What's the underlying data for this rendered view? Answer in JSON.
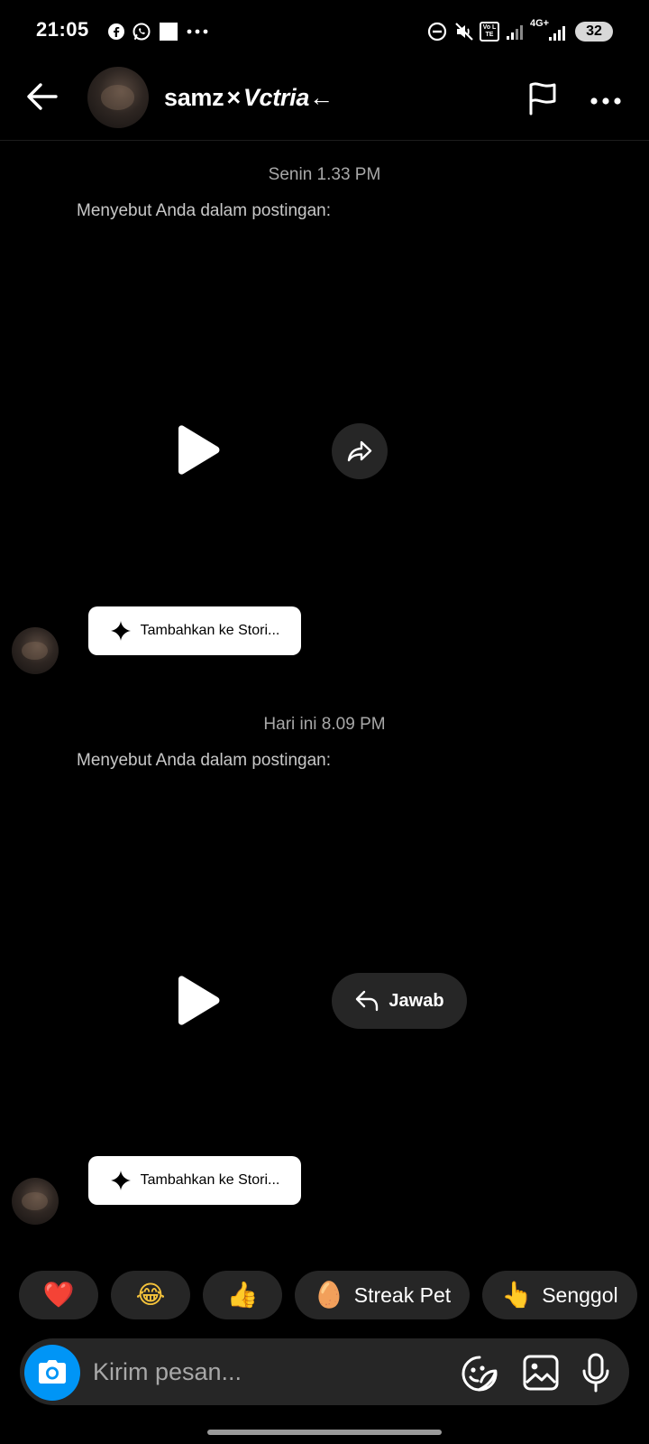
{
  "status_bar": {
    "time": "21:05",
    "left_icons": [
      "facebook-icon",
      "whatsapp-icon",
      "square-icon",
      "more-dots-icon"
    ],
    "right_icons": [
      "dnd-icon",
      "mute-icon",
      "volte-icon",
      "signal-icon",
      "4g-signal-icon"
    ],
    "network": "4G+",
    "volte": "Vo LTE",
    "battery": "32"
  },
  "header": {
    "name_part1": "samz",
    "name_cross": "×",
    "name_part2": "Vctria",
    "name_arrow": "←"
  },
  "messages": [
    {
      "timestamp": "Senin 1.33 PM",
      "mention_text": "Menyebut Anda dalam postingan:",
      "action_label": "",
      "story_button": "Tambahkan ke Stori..."
    },
    {
      "timestamp": "Hari ini 8.09 PM",
      "mention_text": "Menyebut Anda dalam postingan:",
      "action_label": "Jawab",
      "story_button": "Tambahkan ke Stori..."
    }
  ],
  "quick_reactions": [
    {
      "emoji": "❤️",
      "label": ""
    },
    {
      "emoji": "😂",
      "label": ""
    },
    {
      "emoji": "👍",
      "label": ""
    },
    {
      "emoji": "🥚",
      "label": "Streak Pet"
    },
    {
      "emoji": "👆",
      "label": "Senggol"
    }
  ],
  "composer": {
    "placeholder": "Kirim pesan..."
  },
  "colors": {
    "background": "#000000",
    "surface": "#262626",
    "accent": "#0095f6",
    "muted_text": "#a8a8a8"
  }
}
